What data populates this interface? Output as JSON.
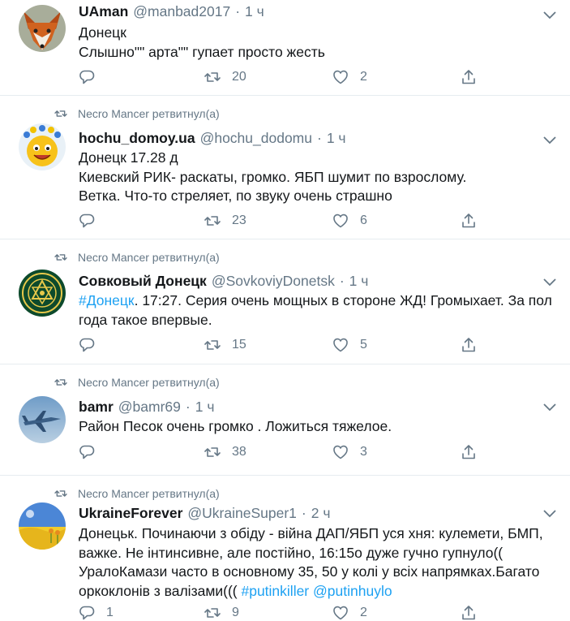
{
  "retweet_icon": "retweet-icon",
  "tweets": [
    {
      "retweeted_by": "",
      "name": "UAman",
      "handle": "@manbad2017",
      "sep": "·",
      "time": "1 ч",
      "avatar_icon": "fox-avatar",
      "lines": [
        "Донецк",
        "Слышно\"\" арта\"\" гупает просто жесть"
      ],
      "replies": "",
      "retweets": "20",
      "likes": "2"
    },
    {
      "retweeted_by": "Necro Mancer ретвитнул(а)",
      "name": "hochu_domoy.ua",
      "handle": "@hochu_dodomu",
      "sep": "·",
      "time": "1 ч",
      "avatar_icon": "smiley-avatar",
      "lines": [
        "Донецк 17.28 д",
        "Киевский РИК- раскаты, громко. ЯБП шумит по взрослому.",
        "Ветка. Что-то стреляет, по звуку очень страшно"
      ],
      "replies": "",
      "retweets": "23",
      "likes": "6"
    },
    {
      "retweeted_by": "Necro Mancer ретвитнул(а)",
      "name": "Совковый Донецк",
      "handle": "@SovkoviyDonetsk",
      "sep": "·",
      "time": "1 ч",
      "avatar_icon": "emblem-avatar",
      "hashtag": "#Донецк",
      "lines": [
        ". 17:27. Серия очень мощных в стороне ЖД! Громыхает. За пол",
        "года такое впервые."
      ],
      "replies": "",
      "retweets": "15",
      "likes": "5"
    },
    {
      "retweeted_by": "Necro Mancer ретвитнул(а)",
      "name": "bamr",
      "handle": "@bamr69",
      "sep": "·",
      "time": "1 ч",
      "avatar_icon": "jet-avatar",
      "lines": [
        "Район Песок очень громко . Ложиться тяжелое."
      ],
      "replies": "",
      "retweets": "38",
      "likes": "3"
    },
    {
      "retweeted_by": "Necro Mancer ретвитнул(а)",
      "name": "UkraineForever",
      "handle": "@UkraineSuper1",
      "sep": "·",
      "time": "2 ч",
      "avatar_icon": "ukraine-field-avatar",
      "lines": [
        "Донецьк. Починаючи з обіду - війна ДАП/ЯБП уся хня: кулемети, БМП,",
        "важке. Не інтинсивне, але постійно, 16:15о дуже гучно гупнуло((",
        "УралоКамази часто в основному 35, 50 у колі у всіх напрямках.Багато",
        "оркоклонів з валізами((( "
      ],
      "hashtags": [
        "#putinkiller",
        "@putinhuylo"
      ],
      "replies": "1",
      "retweets": "9",
      "likes": "2"
    }
  ]
}
